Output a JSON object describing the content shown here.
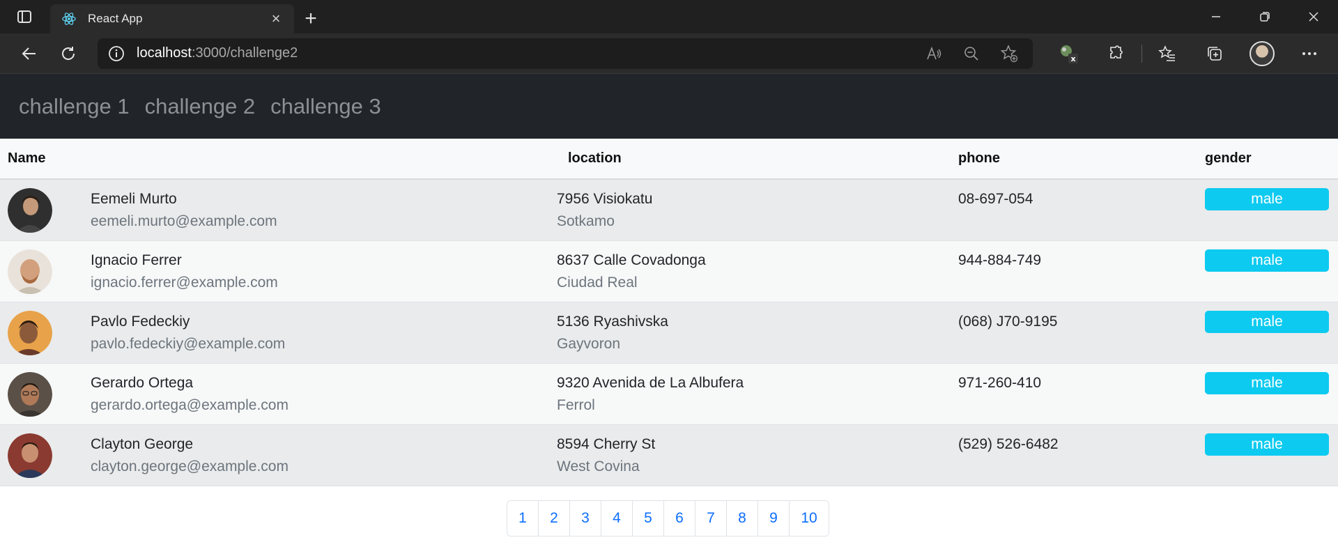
{
  "browser": {
    "tab_title": "React App",
    "url_host": "localhost",
    "url_path": ":3000/challenge2"
  },
  "nav": {
    "links": [
      "challenge 1",
      "challenge 2",
      "challenge 3"
    ]
  },
  "table": {
    "headers": {
      "name": "Name",
      "location": "location",
      "phone": "phone",
      "gender": "gender"
    },
    "rows": [
      {
        "name": "Eemeli Murto",
        "email": "eemeli.murto@example.com",
        "street": "7956 Visiokatu",
        "city": "Sotkamo",
        "phone": "08-697-054",
        "gender": "male"
      },
      {
        "name": "Ignacio Ferrer",
        "email": "ignacio.ferrer@example.com",
        "street": "8637 Calle Covadonga",
        "city": "Ciudad Real",
        "phone": "944-884-749",
        "gender": "male"
      },
      {
        "name": "Pavlo Fedeckiy",
        "email": "pavlo.fedeckiy@example.com",
        "street": "5136 Ryashivska",
        "city": "Gayvoron",
        "phone": "(068) J70-9195",
        "gender": "male"
      },
      {
        "name": "Gerardo Ortega",
        "email": "gerardo.ortega@example.com",
        "street": "9320 Avenida de La Albufera",
        "city": "Ferrol",
        "phone": "971-260-410",
        "gender": "male"
      },
      {
        "name": "Clayton George",
        "email": "clayton.george@example.com",
        "street": "8594 Cherry St",
        "city": "West Covina",
        "phone": "(529) 526-6482",
        "gender": "male"
      }
    ]
  },
  "pagination": [
    "1",
    "2",
    "3",
    "4",
    "5",
    "6",
    "7",
    "8",
    "9",
    "10"
  ],
  "colors": {
    "navbar_bg": "#212529",
    "badge_info": "#0dcaf0",
    "link_primary": "#0d6efd"
  }
}
